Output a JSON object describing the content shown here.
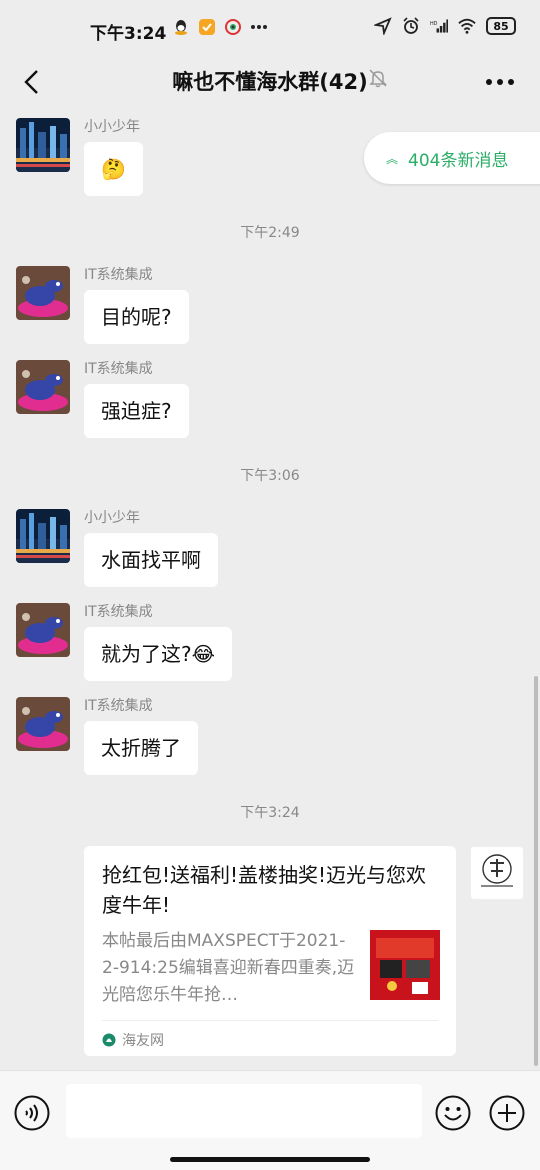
{
  "status_bar": {
    "time": "下午3:24",
    "battery": "85"
  },
  "header": {
    "title": "嘛也不懂海水群(42)"
  },
  "new_messages": {
    "label": "404条新消息"
  },
  "messages": [
    {
      "sender": "小小少年",
      "text": "🤔"
    },
    {
      "sender": "IT系统集成",
      "text": "目的呢?"
    },
    {
      "sender": "IT系统集成",
      "text": "强迫症?"
    },
    {
      "sender": "小小少年",
      "text": "水面找平啊"
    },
    {
      "sender": "IT系统集成",
      "text": "就为了这?😂"
    },
    {
      "sender": "IT系统集成",
      "text": "太折腾了"
    }
  ],
  "timestamps": [
    "下午2:49",
    "下午3:06",
    "下午3:24"
  ],
  "link_card": {
    "title": "抢红包!送福利!盖楼抽奖!迈光与您欢度牛年!",
    "description": "本帖最后由MAXSPECT于2021-2-914:25编辑喜迎新春四重奏,迈光陪您乐牛年抢…",
    "source": "海友网"
  },
  "colors": {
    "accent": "#2aae67",
    "background": "#ededed",
    "bubble": "#ffffff"
  }
}
